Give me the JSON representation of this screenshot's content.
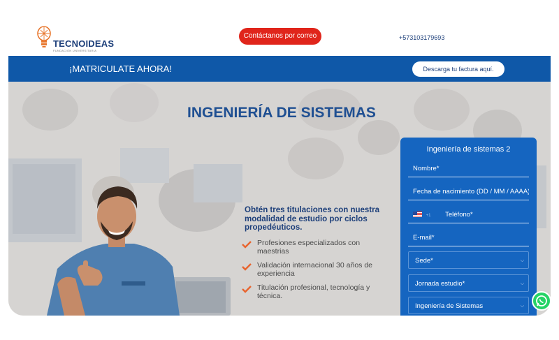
{
  "header": {
    "logo_name": "TECNOIDEAS",
    "logo_subtitle": "FUNDACIÓN UNIVERSITARIA",
    "contact_button": "Contáctanos por correo",
    "phone": "+573103179693"
  },
  "band": {
    "title": "¡MATRICULATE AHORA!",
    "invoice_button": "Descarga tu factura aquí."
  },
  "hero": {
    "title": "INGENIERÍA DE SISTEMAS",
    "promo": "Obtén tres titulaciones con nuestra modalidad de estudio por ciclos propedéuticos.",
    "bullets": [
      "Profesiones especializados con maestrias",
      "Validación internacional 30 años de experiencia",
      "Titulación profesional, tecnología y técnica."
    ],
    "shirt_text": "TECNOIDEAS"
  },
  "form": {
    "title": "Ingeniería de sistemas 2",
    "name_placeholder": "Nombre*",
    "birth_placeholder": "Fecha de nacimiento (DD / MM / AAAA)*",
    "phone_code": "+1",
    "phone_placeholder": "Teléfono*",
    "email_placeholder": "E-mail*",
    "sede": "Sede*",
    "jornada": "Jornada estudio*",
    "program": "Ingeniería de Sistemas"
  },
  "colors": {
    "brand_blue": "#0f58a8",
    "form_blue": "#1565c0",
    "accent_red": "#e0251b",
    "whatsapp_green": "#25d366"
  }
}
